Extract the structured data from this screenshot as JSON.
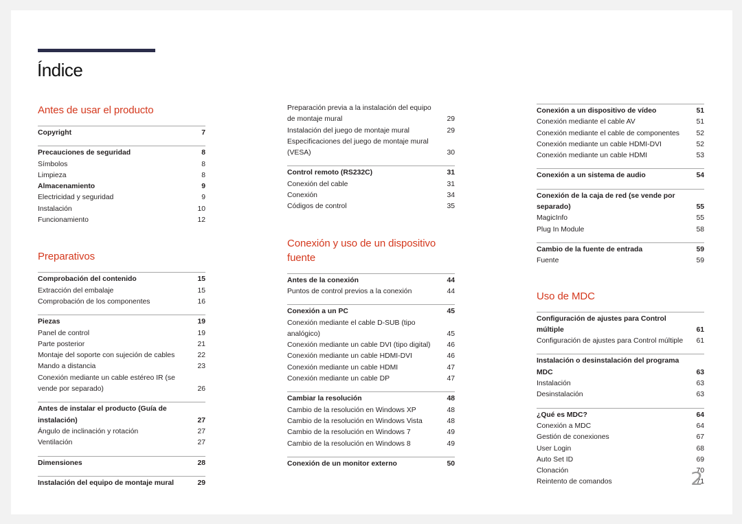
{
  "title": "Índice",
  "page_number": "2",
  "colors": {
    "accent": "#d4381d",
    "bar": "#2b2d4a",
    "rule": "#a6a6a6"
  },
  "col1": {
    "sections": [
      {
        "title": "Antes de usar el producto",
        "groups": [
          {
            "entries": [
              {
                "label": "Copyright",
                "page": "7",
                "bold": true
              }
            ]
          },
          {
            "entries": [
              {
                "label": "Precauciones de seguridad",
                "page": "8",
                "bold": true
              },
              {
                "label": "Símbolos",
                "page": "8"
              },
              {
                "label": "Limpieza",
                "page": "8"
              },
              {
                "label": "Almacenamiento",
                "page": "9",
                "sub": true
              },
              {
                "label": "Electricidad y seguridad",
                "page": "9"
              },
              {
                "label": "Instalación",
                "page": "10"
              },
              {
                "label": "Funcionamiento",
                "page": "12"
              }
            ]
          }
        ]
      },
      {
        "title": "Preparativos",
        "groups": [
          {
            "entries": [
              {
                "label": "Comprobación del contenido",
                "page": "15",
                "bold": true
              },
              {
                "label": "Extracción del embalaje",
                "page": "15"
              },
              {
                "label": "Comprobación de los componentes",
                "page": "16"
              }
            ]
          },
          {
            "entries": [
              {
                "label": "Piezas",
                "page": "19",
                "bold": true
              },
              {
                "label": "Panel de control",
                "page": "19"
              },
              {
                "label": "Parte posterior",
                "page": "21"
              },
              {
                "label": "Montaje del soporte con sujeción de cables",
                "page": "22"
              },
              {
                "label": "Mando a distancia",
                "page": "23"
              },
              {
                "label": "Conexión mediante un cable estéreo IR (se vende por separado)",
                "page": "26"
              }
            ]
          },
          {
            "entries": [
              {
                "label": "Antes de instalar el producto (Guía de instalación)",
                "page": "27",
                "bold": true
              },
              {
                "label": "Ángulo de inclinación y rotación",
                "page": "27"
              },
              {
                "label": "Ventilación",
                "page": "27"
              }
            ]
          },
          {
            "entries": [
              {
                "label": "Dimensiones",
                "page": "28",
                "bold": true
              }
            ]
          },
          {
            "entries": [
              {
                "label": "Instalación del equipo de montaje mural",
                "page": "29",
                "bold": true
              }
            ]
          }
        ]
      }
    ]
  },
  "col2": {
    "continued": [
      {
        "label": "Preparación previa a la instalación del equipo de montaje mural",
        "page": "29"
      },
      {
        "label": "Instalación del juego de montaje mural",
        "page": "29"
      },
      {
        "label": "Especificaciones del juego de montaje mural (VESA)",
        "page": "30"
      }
    ],
    "groups_top": [
      {
        "entries": [
          {
            "label": "Control remoto (RS232C)",
            "page": "31",
            "bold": true
          },
          {
            "label": "Conexión del cable",
            "page": "31"
          },
          {
            "label": "Conexión",
            "page": "34"
          },
          {
            "label": "Códigos de control",
            "page": "35"
          }
        ]
      }
    ],
    "section": {
      "title": "Conexión y uso de un dispositivo fuente",
      "groups": [
        {
          "entries": [
            {
              "label": "Antes de la conexión",
              "page": "44",
              "bold": true
            },
            {
              "label": "Puntos de control previos a la conexión",
              "page": "44"
            }
          ]
        },
        {
          "entries": [
            {
              "label": "Conexión a un PC",
              "page": "45",
              "bold": true
            },
            {
              "label": "Conexión mediante el cable D-SUB (tipo analógico)",
              "page": "45"
            },
            {
              "label": "Conexión mediante un cable DVI (tipo digital)",
              "page": "46"
            },
            {
              "label": "Conexión mediante un cable HDMI-DVI",
              "page": "46"
            },
            {
              "label": "Conexión mediante un cable HDMI",
              "page": "47"
            },
            {
              "label": "Conexión mediante un cable DP",
              "page": "47"
            }
          ]
        },
        {
          "entries": [
            {
              "label": "Cambiar la resolución",
              "page": "48",
              "bold": true
            },
            {
              "label": "Cambio de la resolución en Windows XP",
              "page": "48"
            },
            {
              "label": "Cambio de la resolución en Windows Vista",
              "page": "48"
            },
            {
              "label": "Cambio de la resolución en Windows 7",
              "page": "49"
            },
            {
              "label": "Cambio de la resolución en Windows 8",
              "page": "49"
            }
          ]
        },
        {
          "entries": [
            {
              "label": "Conexión de un monitor externo",
              "page": "50",
              "bold": true
            }
          ]
        }
      ]
    }
  },
  "col3": {
    "groups_top": [
      {
        "entries": [
          {
            "label": "Conexión a un dispositivo de vídeo",
            "page": "51",
            "bold": true
          },
          {
            "label": "Conexión mediante el cable AV",
            "page": "51"
          },
          {
            "label": "Conexión mediante el cable de componentes",
            "page": "52"
          },
          {
            "label": "Conexión mediante un cable HDMI-DVI",
            "page": "52"
          },
          {
            "label": "Conexión mediante un cable HDMI",
            "page": "53"
          }
        ]
      },
      {
        "entries": [
          {
            "label": "Conexión a un sistema de audio",
            "page": "54",
            "bold": true
          }
        ]
      },
      {
        "entries": [
          {
            "label": "Conexión de la caja de red (se vende por separado)",
            "page": "55",
            "bold": true
          },
          {
            "label": "MagicInfo",
            "page": "55"
          },
          {
            "label": "Plug In Module",
            "page": "58"
          }
        ]
      },
      {
        "entries": [
          {
            "label": "Cambio de la fuente de entrada",
            "page": "59",
            "bold": true
          },
          {
            "label": "Fuente",
            "page": "59"
          }
        ]
      }
    ],
    "section": {
      "title": "Uso de MDC",
      "groups": [
        {
          "entries": [
            {
              "label": "Configuración de ajustes para Control múltiple",
              "page": "61",
              "bold": true
            },
            {
              "label": "Configuración de ajustes para Control múltiple",
              "page": "61"
            }
          ]
        },
        {
          "entries": [
            {
              "label": "Instalación o desinstalación del programa MDC",
              "page": "63",
              "bold": true
            },
            {
              "label": "Instalación",
              "page": "63"
            },
            {
              "label": "Desinstalación",
              "page": "63"
            }
          ]
        },
        {
          "entries": [
            {
              "label": "¿Qué es MDC?",
              "page": "64",
              "bold": true
            },
            {
              "label": "Conexión a MDC",
              "page": "64"
            },
            {
              "label": "Gestión de conexiones",
              "page": "67"
            },
            {
              "label": "User Login",
              "page": "68"
            },
            {
              "label": "Auto Set ID",
              "page": "69"
            },
            {
              "label": "Clonación",
              "page": "70"
            },
            {
              "label": "Reintento de comandos",
              "page": "71"
            }
          ]
        }
      ]
    }
  }
}
